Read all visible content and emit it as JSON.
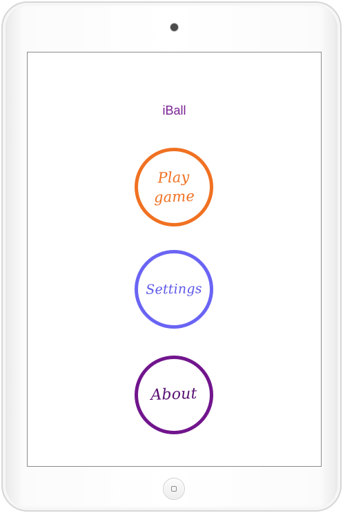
{
  "app": {
    "title": "iBall"
  },
  "menu": {
    "play_label": "Play game",
    "settings_label": "Settings",
    "about_label": "About"
  },
  "icons": {
    "camera": "camera-icon",
    "home": "home-button-icon"
  },
  "colors": {
    "title": "#7a1f93",
    "play": "#f07122",
    "settings": "#6a64f4",
    "about": "#71158d"
  }
}
